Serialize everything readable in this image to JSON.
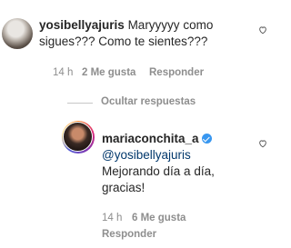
{
  "comment1": {
    "username": "yosibellyajuris",
    "text_line1": "Maryyyyy como",
    "text_line2": "sigues??? Como te sientes???",
    "time": "14 h",
    "likes": "2 Me gusta",
    "reply": "Responder"
  },
  "toggle": {
    "label": "Ocultar respuestas"
  },
  "reply1": {
    "username": "mariaconchita_a",
    "verified_icon": "verified-badge-icon",
    "mention": "@yosibellyajuris",
    "text_line1": "Mejorando día a día,",
    "text_line2": "gracias!",
    "time": "14 h",
    "likes": "6 Me gusta",
    "reply": "Responder"
  },
  "icons": {
    "like": "heart-outline-icon"
  },
  "colors": {
    "accent": "#3897f0",
    "mention": "#00376b",
    "muted": "#8e8e8e"
  }
}
